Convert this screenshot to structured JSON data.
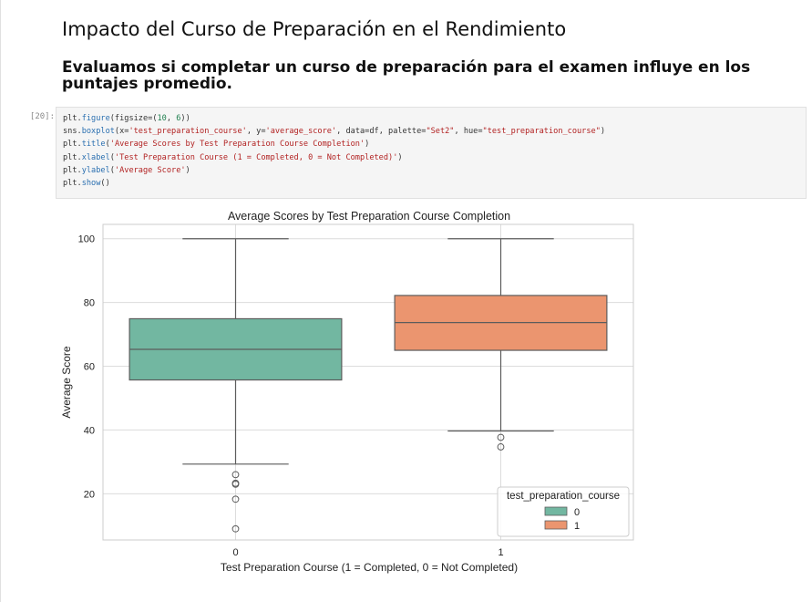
{
  "notebook": {
    "markdown_h2": "Impacto del Curso de Preparación en el Rendimiento",
    "markdown_h3": "Evaluamos si completar un curso de preparación para el examen influye en los puntajes promedio.",
    "cell_prompt": "[20]:",
    "code_lines": [
      "plt.figure(figsize=(10, 6))",
      "sns.boxplot(x='test_preparation_course', y='average_score', data=df, palette=\"Set2\", hue=\"test_preparation_course\")",
      "plt.title('Average Scores by Test Preparation Course Completion')",
      "plt.xlabel('Test Preparation Course (1 = Completed, 0 = Not Completed)')",
      "plt.ylabel('Average Score')",
      "plt.show()"
    ]
  },
  "chart_data": {
    "type": "boxplot",
    "title": "Average Scores by Test Preparation Course Completion",
    "xlabel": "Test Preparation Course (1 = Completed, 0 = Not Completed)",
    "ylabel": "Average Score",
    "categories": [
      "0",
      "1"
    ],
    "ylim": [
      5.5,
      104.5
    ],
    "yticks": [
      20,
      40,
      60,
      80,
      100
    ],
    "grid": true,
    "legend": {
      "title": "test_preparation_course",
      "placement": "lower-right",
      "entries": [
        {
          "label": "0",
          "color": "#72b7a1"
        },
        {
          "label": "1",
          "color": "#eb956f"
        }
      ]
    },
    "boxes": [
      {
        "category": "0",
        "color": "#72b7a1",
        "whisker_low": 29.3,
        "q1": 55.7,
        "median": 65.3,
        "q3": 74.9,
        "whisker_high": 100,
        "outliers": [
          26.0,
          23.3,
          23.0,
          18.3,
          9.0
        ]
      },
      {
        "category": "1",
        "color": "#eb956f",
        "whisker_low": 39.7,
        "q1": 65.0,
        "median": 73.7,
        "q3": 82.2,
        "whisker_high": 100,
        "outliers": [
          37.7,
          34.7
        ]
      }
    ]
  }
}
